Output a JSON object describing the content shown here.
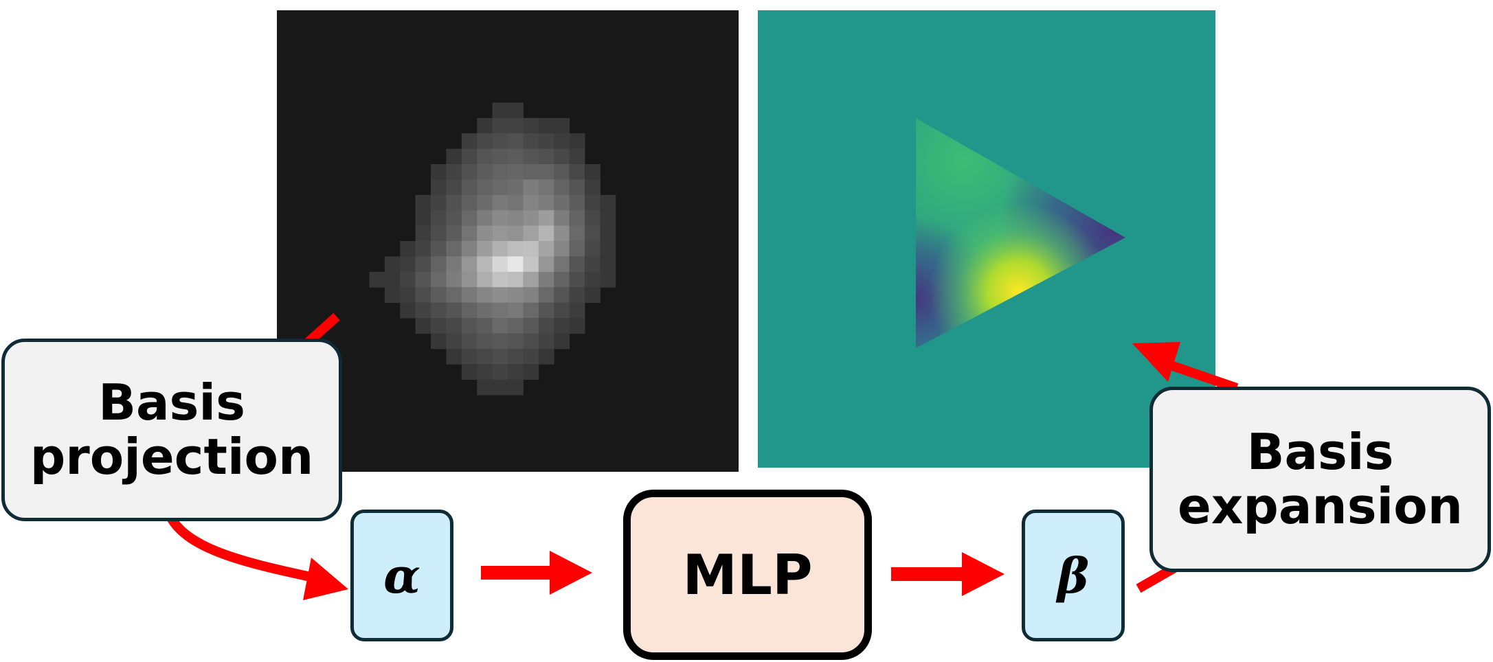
{
  "left_panel": {
    "kind": "grayscale pixelated input image",
    "background_color": "#181818",
    "pixel_grid": [
      [
        0,
        0,
        0,
        0,
        0,
        0,
        0,
        0,
        0,
        0,
        0,
        0,
        0,
        0,
        0,
        0,
        0,
        0,
        0,
        0,
        0,
        0,
        0,
        0,
        0,
        0,
        0,
        0,
        0,
        0
      ],
      [
        0,
        0,
        0,
        0,
        0,
        0,
        0,
        0,
        0,
        0,
        0,
        0,
        0,
        0,
        0,
        0,
        0,
        0,
        0,
        0,
        0,
        0,
        0,
        0,
        0,
        0,
        0,
        0,
        0,
        0
      ],
      [
        0,
        0,
        0,
        0,
        0,
        0,
        0,
        0,
        0,
        0,
        0,
        0,
        0,
        0,
        0,
        0,
        0,
        0,
        0,
        0,
        0,
        0,
        0,
        0,
        0,
        0,
        0,
        0,
        0,
        0
      ],
      [
        0,
        0,
        0,
        0,
        0,
        0,
        0,
        0,
        0,
        0,
        0,
        0,
        0,
        0,
        0,
        0,
        0,
        0,
        0,
        0,
        0,
        0,
        0,
        0,
        0,
        0,
        0,
        0,
        0,
        0
      ],
      [
        0,
        0,
        0,
        0,
        0,
        0,
        0,
        0,
        0,
        0,
        0,
        0,
        0,
        0,
        0,
        0,
        0,
        0,
        0,
        0,
        0,
        0,
        0,
        0,
        0,
        0,
        0,
        0,
        0,
        0
      ],
      [
        0,
        0,
        0,
        0,
        0,
        0,
        0,
        0,
        0,
        0,
        0,
        0,
        0,
        0,
        0,
        0,
        0,
        0,
        0,
        0,
        0,
        0,
        0,
        0,
        0,
        0,
        0,
        0,
        0,
        0
      ],
      [
        0,
        0,
        0,
        0,
        0,
        0,
        0,
        0,
        0,
        0,
        0,
        0,
        0,
        0,
        0.02,
        0.02,
        0,
        0,
        0,
        0,
        0,
        0,
        0,
        0,
        0,
        0,
        0,
        0,
        0,
        0
      ],
      [
        0,
        0,
        0,
        0,
        0,
        0,
        0,
        0,
        0,
        0,
        0,
        0,
        0,
        0.02,
        0.04,
        0.04,
        0.03,
        0.02,
        0.02,
        0,
        0,
        0,
        0,
        0,
        0,
        0,
        0,
        0,
        0,
        0
      ],
      [
        0,
        0,
        0,
        0,
        0,
        0,
        0,
        0,
        0,
        0,
        0,
        0,
        0.03,
        0.05,
        0.06,
        0.07,
        0.05,
        0.04,
        0.03,
        0.02,
        0,
        0,
        0,
        0,
        0,
        0,
        0,
        0,
        0,
        0
      ],
      [
        0,
        0,
        0,
        0,
        0,
        0,
        0,
        0,
        0,
        0,
        0,
        0.02,
        0.05,
        0.08,
        0.09,
        0.1,
        0.08,
        0.07,
        0.05,
        0.03,
        0,
        0,
        0,
        0,
        0,
        0,
        0,
        0,
        0,
        0
      ],
      [
        0,
        0,
        0,
        0,
        0,
        0,
        0,
        0,
        0,
        0,
        0.02,
        0.04,
        0.07,
        0.1,
        0.12,
        0.13,
        0.12,
        0.12,
        0.09,
        0.05,
        0.02,
        0,
        0,
        0,
        0,
        0,
        0,
        0,
        0,
        0
      ],
      [
        0,
        0,
        0,
        0,
        0,
        0,
        0,
        0,
        0,
        0,
        0.03,
        0.05,
        0.09,
        0.12,
        0.14,
        0.16,
        0.22,
        0.18,
        0.12,
        0.08,
        0.03,
        0,
        0,
        0,
        0,
        0,
        0,
        0,
        0,
        0
      ],
      [
        0,
        0,
        0,
        0,
        0,
        0,
        0,
        0,
        0,
        0.02,
        0.04,
        0.07,
        0.11,
        0.15,
        0.2,
        0.18,
        0.25,
        0.22,
        0.16,
        0.1,
        0.04,
        0.02,
        0,
        0,
        0,
        0,
        0,
        0,
        0,
        0
      ],
      [
        0,
        0,
        0,
        0,
        0,
        0,
        0,
        0,
        0,
        0.02,
        0.05,
        0.08,
        0.14,
        0.22,
        0.28,
        0.26,
        0.3,
        0.38,
        0.22,
        0.12,
        0.05,
        0.02,
        0,
        0,
        0,
        0,
        0,
        0,
        0,
        0
      ],
      [
        0,
        0,
        0,
        0,
        0,
        0,
        0,
        0,
        0,
        0.03,
        0.06,
        0.1,
        0.18,
        0.3,
        0.34,
        0.32,
        0.4,
        0.52,
        0.3,
        0.14,
        0.06,
        0.02,
        0,
        0,
        0,
        0,
        0,
        0,
        0,
        0
      ],
      [
        0,
        0,
        0,
        0,
        0,
        0,
        0,
        0,
        0.02,
        0.04,
        0.08,
        0.14,
        0.24,
        0.38,
        0.5,
        0.58,
        0.6,
        0.42,
        0.26,
        0.12,
        0.05,
        0.02,
        0,
        0,
        0,
        0,
        0,
        0,
        0,
        0
      ],
      [
        0,
        0,
        0,
        0,
        0,
        0,
        0,
        0.02,
        0.03,
        0.06,
        0.12,
        0.2,
        0.34,
        0.55,
        0.78,
        0.92,
        0.64,
        0.34,
        0.18,
        0.08,
        0.04,
        0.02,
        0,
        0,
        0,
        0,
        0,
        0,
        0,
        0
      ],
      [
        0,
        0,
        0,
        0,
        0,
        0,
        0.02,
        0.02,
        0.04,
        0.08,
        0.14,
        0.22,
        0.32,
        0.48,
        0.62,
        0.58,
        0.4,
        0.22,
        0.12,
        0.06,
        0.03,
        0.02,
        0,
        0,
        0,
        0,
        0,
        0,
        0,
        0
      ],
      [
        0,
        0,
        0,
        0,
        0,
        0,
        0,
        0.02,
        0.03,
        0.06,
        0.1,
        0.14,
        0.2,
        0.26,
        0.3,
        0.28,
        0.24,
        0.14,
        0.08,
        0.04,
        0.02,
        0,
        0,
        0,
        0,
        0,
        0,
        0,
        0,
        0
      ],
      [
        0,
        0,
        0,
        0,
        0,
        0,
        0,
        0,
        0.02,
        0.04,
        0.06,
        0.08,
        0.12,
        0.16,
        0.18,
        0.2,
        0.14,
        0.08,
        0.05,
        0.03,
        0,
        0,
        0,
        0,
        0,
        0,
        0,
        0,
        0,
        0
      ],
      [
        0,
        0,
        0,
        0,
        0,
        0,
        0,
        0,
        0,
        0.02,
        0.04,
        0.05,
        0.08,
        0.1,
        0.14,
        0.12,
        0.09,
        0.05,
        0.03,
        0.02,
        0,
        0,
        0,
        0,
        0,
        0,
        0,
        0,
        0,
        0
      ],
      [
        0,
        0,
        0,
        0,
        0,
        0,
        0,
        0,
        0,
        0,
        0.02,
        0.04,
        0.06,
        0.08,
        0.09,
        0.08,
        0.06,
        0.04,
        0.02,
        0,
        0,
        0,
        0,
        0,
        0,
        0,
        0,
        0,
        0,
        0
      ],
      [
        0,
        0,
        0,
        0,
        0,
        0,
        0,
        0,
        0,
        0,
        0,
        0.02,
        0.04,
        0.05,
        0.06,
        0.05,
        0.04,
        0.02,
        0,
        0,
        0,
        0,
        0,
        0,
        0,
        0,
        0,
        0,
        0,
        0
      ],
      [
        0,
        0,
        0,
        0,
        0,
        0,
        0,
        0,
        0,
        0,
        0,
        0,
        0.02,
        0.03,
        0.04,
        0.03,
        0.02,
        0,
        0,
        0,
        0,
        0,
        0,
        0,
        0,
        0,
        0,
        0,
        0,
        0
      ],
      [
        0,
        0,
        0,
        0,
        0,
        0,
        0,
        0,
        0,
        0,
        0,
        0,
        0,
        0.02,
        0.02,
        0.02,
        0,
        0,
        0,
        0,
        0,
        0,
        0,
        0,
        0,
        0,
        0,
        0,
        0,
        0
      ],
      [
        0,
        0,
        0,
        0,
        0,
        0,
        0,
        0,
        0,
        0,
        0,
        0,
        0,
        0,
        0,
        0,
        0,
        0,
        0,
        0,
        0,
        0,
        0,
        0,
        0,
        0,
        0,
        0,
        0,
        0
      ],
      [
        0,
        0,
        0,
        0,
        0,
        0,
        0,
        0,
        0,
        0,
        0,
        0,
        0,
        0,
        0,
        0,
        0,
        0,
        0,
        0,
        0,
        0,
        0,
        0,
        0,
        0,
        0,
        0,
        0,
        0
      ],
      [
        0,
        0,
        0,
        0,
        0,
        0,
        0,
        0,
        0,
        0,
        0,
        0,
        0,
        0,
        0,
        0,
        0,
        0,
        0,
        0,
        0,
        0,
        0,
        0,
        0,
        0,
        0,
        0,
        0,
        0
      ],
      [
        0,
        0,
        0,
        0,
        0,
        0,
        0,
        0,
        0,
        0,
        0,
        0,
        0,
        0,
        0,
        0,
        0,
        0,
        0,
        0,
        0,
        0,
        0,
        0,
        0,
        0,
        0,
        0,
        0,
        0
      ],
      [
        0,
        0,
        0,
        0,
        0,
        0,
        0,
        0,
        0,
        0,
        0,
        0,
        0,
        0,
        0,
        0,
        0,
        0,
        0,
        0,
        0,
        0,
        0,
        0,
        0,
        0,
        0,
        0,
        0,
        0
      ]
    ]
  },
  "right_panel": {
    "kind": "triangular field on teal background",
    "background_color": "#21968b",
    "colors": {
      "green": "#3ebc74",
      "teal": "#21968b",
      "blue": "#3b528b",
      "purple": "#46327e",
      "yellow": "#fde725"
    }
  },
  "callouts": {
    "projection": {
      "line1": "Basis",
      "line2": "projection"
    },
    "expansion": {
      "line1": "Basis",
      "line2": "expansion"
    }
  },
  "coefficients": {
    "alpha": "α",
    "beta": "β"
  },
  "mlp": {
    "label": "MLP"
  },
  "colors": {
    "arrow": "#ff0000",
    "callout_fill": "#f2f2f2",
    "callout_border": "#0f2b36",
    "coef_fill": "#cdeefa",
    "mlp_fill": "#fbe5d8",
    "mlp_border": "#000000"
  }
}
